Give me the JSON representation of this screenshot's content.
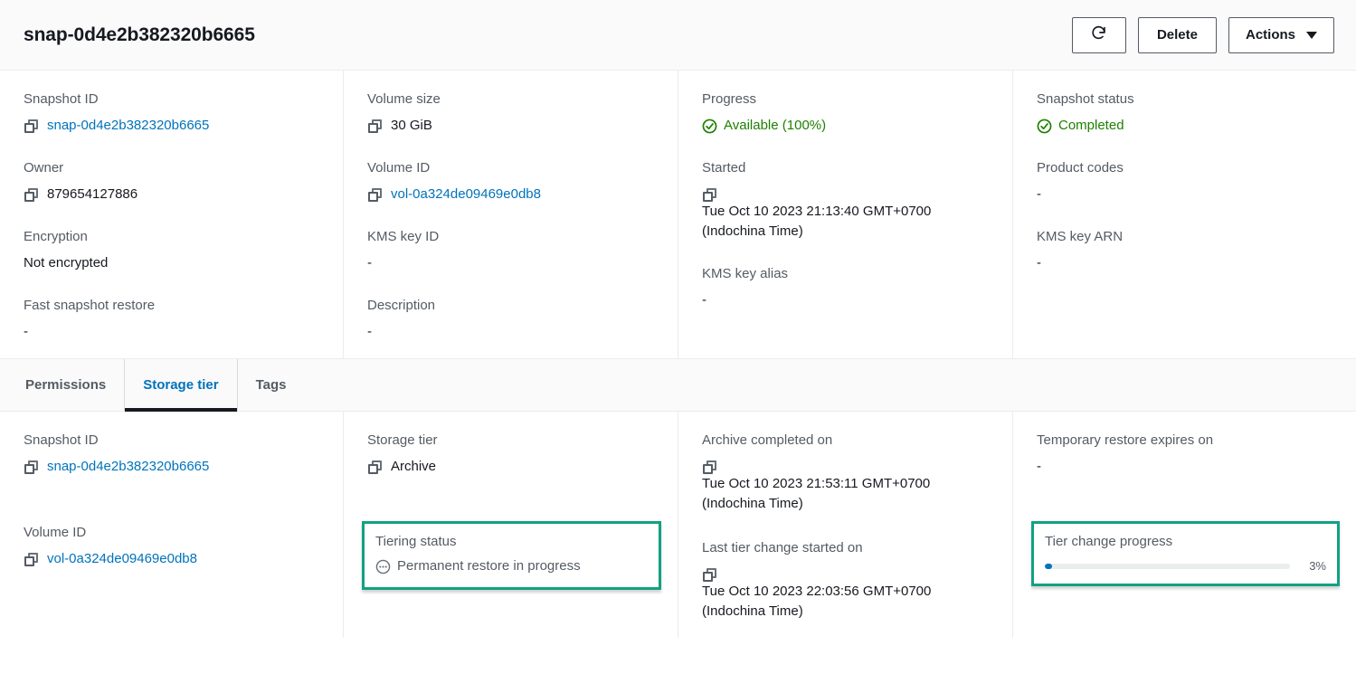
{
  "header": {
    "title": "snap-0d4e2b382320b6665",
    "refresh_icon": "refresh-icon",
    "delete_label": "Delete",
    "actions_label": "Actions"
  },
  "colors": {
    "link": "#0073bb",
    "success": "#1d8102",
    "highlight_border": "#11a184",
    "progress_fill": "#0073bb",
    "label": "#545b64"
  },
  "summary": {
    "col1": [
      {
        "label": "Snapshot ID",
        "value": "snap-0d4e2b382320b6665",
        "type": "link",
        "copy": true
      },
      {
        "label": "Owner",
        "value": "879654127886",
        "type": "text",
        "copy": true
      },
      {
        "label": "Encryption",
        "value": "Not encrypted",
        "type": "text",
        "copy": false
      },
      {
        "label": "Fast snapshot restore",
        "value": "-",
        "type": "text",
        "copy": false
      }
    ],
    "col2": [
      {
        "label": "Volume size",
        "value": "30 GiB",
        "type": "text",
        "copy": true
      },
      {
        "label": "Volume ID",
        "value": "vol-0a324de09469e0db8",
        "type": "link",
        "copy": true
      },
      {
        "label": "KMS key ID",
        "value": "-",
        "type": "text",
        "copy": false
      },
      {
        "label": "Description",
        "value": "-",
        "type": "text",
        "copy": false
      }
    ],
    "col3": [
      {
        "label": "Progress",
        "value": "Available (100%)",
        "type": "status-ok",
        "copy": false
      },
      {
        "label": "Started",
        "value": "Tue Oct 10 2023 21:13:40 GMT+0700 (Indochina Time)",
        "type": "text",
        "copy": true
      },
      {
        "label": "KMS key alias",
        "value": "-",
        "type": "text",
        "copy": false
      }
    ],
    "col4": [
      {
        "label": "Snapshot status",
        "value": "Completed",
        "type": "status-ok",
        "copy": false
      },
      {
        "label": "Product codes",
        "value": "-",
        "type": "text",
        "copy": false
      },
      {
        "label": "KMS key ARN",
        "value": "-",
        "type": "text",
        "copy": false
      }
    ]
  },
  "tabs": [
    {
      "label": "Permissions",
      "active": false
    },
    {
      "label": "Storage tier",
      "active": true
    },
    {
      "label": "Tags",
      "active": false
    }
  ],
  "storage_tier": {
    "col1": {
      "snapshot_id_label": "Snapshot ID",
      "snapshot_id_value": "snap-0d4e2b382320b6665",
      "volume_id_label": "Volume ID",
      "volume_id_value": "vol-0a324de09469e0db8"
    },
    "col2": {
      "storage_tier_label": "Storage tier",
      "storage_tier_value": "Archive",
      "tiering_status_label": "Tiering status",
      "tiering_status_value": "Permanent restore in progress",
      "tiering_status_icon": "pending-dots-icon"
    },
    "col3": {
      "archive_completed_label": "Archive completed on",
      "archive_completed_value": "Tue Oct 10 2023 21:53:11 GMT+0700 (Indochina Time)",
      "last_tier_change_label": "Last tier change started on",
      "last_tier_change_value": "Tue Oct 10 2023 22:03:56 GMT+0700 (Indochina Time)"
    },
    "col4": {
      "temp_restore_label": "Temporary restore expires on",
      "temp_restore_value": "-",
      "tier_progress_label": "Tier change progress",
      "tier_progress_pct_text": "3%",
      "tier_progress_pct": 3
    }
  }
}
